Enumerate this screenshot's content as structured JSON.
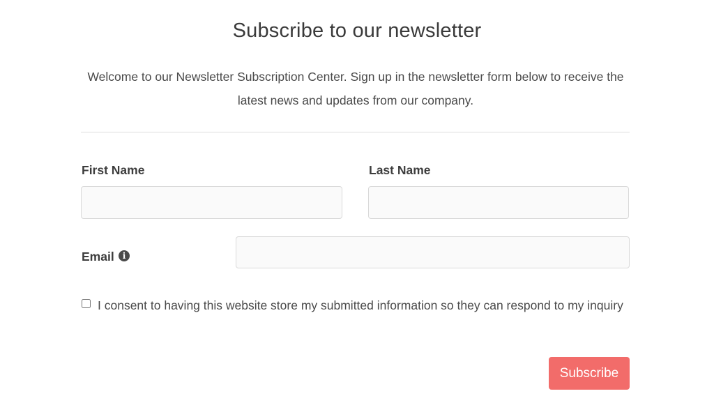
{
  "header": {
    "title": "Subscribe to our newsletter",
    "intro": "Welcome to our Newsletter Subscription Center. Sign up in the newsletter form below to receive the latest news and updates from our company."
  },
  "form": {
    "first_name": {
      "label": "First Name",
      "value": "",
      "placeholder": ""
    },
    "last_name": {
      "label": "Last Name",
      "value": "",
      "placeholder": ""
    },
    "email": {
      "label": "Email",
      "value": "",
      "placeholder": "",
      "help_icon": "info-icon"
    },
    "consent": {
      "checked": false,
      "label": "I consent to having this website store my submitted information so they can respond to my inquiry"
    },
    "submit_label": "Subscribe"
  },
  "colors": {
    "accent": "#f26c6a",
    "text": "#3d3d3d",
    "input_bg": "#fafafa",
    "input_border": "#d9d9d9",
    "divider": "#dddddd"
  }
}
